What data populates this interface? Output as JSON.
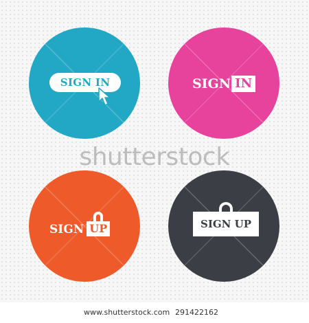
{
  "colors": {
    "cyan": "#22a8c5",
    "pink": "#e7429c",
    "orange": "#ef5a2a",
    "dark": "#3b3e44",
    "white": "#ffffff"
  },
  "icons": [
    {
      "name": "sign-in-button-cursor-icon",
      "label": "SIGN IN"
    },
    {
      "name": "sign-in-boxed-icon",
      "word": "SIGN",
      "boxed": "IN"
    },
    {
      "name": "sign-up-lock-icon",
      "word": "SIGN",
      "boxed": "UP"
    },
    {
      "name": "sign-up-big-lock-icon",
      "label": "SIGN UP"
    }
  ],
  "watermark": "shutterstock",
  "footer": {
    "url": "www.shutterstock.com",
    "image_id": "291422162"
  }
}
